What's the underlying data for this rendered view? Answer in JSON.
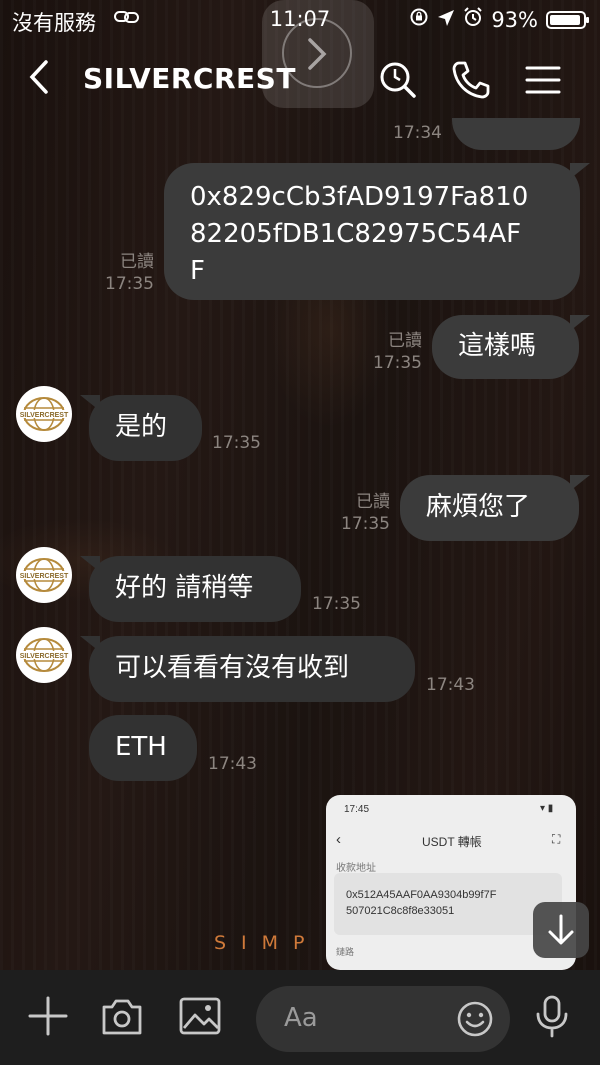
{
  "status": {
    "carrier": "沒有服務",
    "time": "11:07",
    "battery": "93%"
  },
  "header": {
    "title": "SILVERCREST",
    "avatar_text": "SILVERCREST"
  },
  "messages": {
    "m0": {
      "time": "17:34"
    },
    "m1": {
      "text_l1": "0x829cCb3fAD9197Fa810",
      "text_l2": "82205fDB1C82975C54AF",
      "text_l3": "F",
      "read": "已讀",
      "time": "17:35"
    },
    "m2": {
      "text": "這樣嗎",
      "read": "已讀",
      "time": "17:35"
    },
    "m3": {
      "text": "是的",
      "time": "17:35"
    },
    "m4": {
      "text": "麻煩您了",
      "read": "已讀",
      "time": "17:35"
    },
    "m5": {
      "text": "好的 請稍等",
      "time": "17:35"
    },
    "m6": {
      "text": "可以看看有沒有收到",
      "time": "17:43"
    },
    "m7": {
      "text": "ETH",
      "time": "17:43"
    }
  },
  "shared_image": {
    "time": "17:45",
    "title": "USDT 轉帳",
    "label": "收款地址",
    "address_l1": "0x512A45AAF0AA9304b99f7F",
    "address_l2": "507021C8c8f8e33051",
    "label2": "鏈路"
  },
  "watermark": "SIMP",
  "composer": {
    "placeholder": "Aa"
  },
  "colors": {
    "bubble": "#3b3b3b",
    "meta": "#8c8580",
    "watermark": "#d07a3a"
  }
}
